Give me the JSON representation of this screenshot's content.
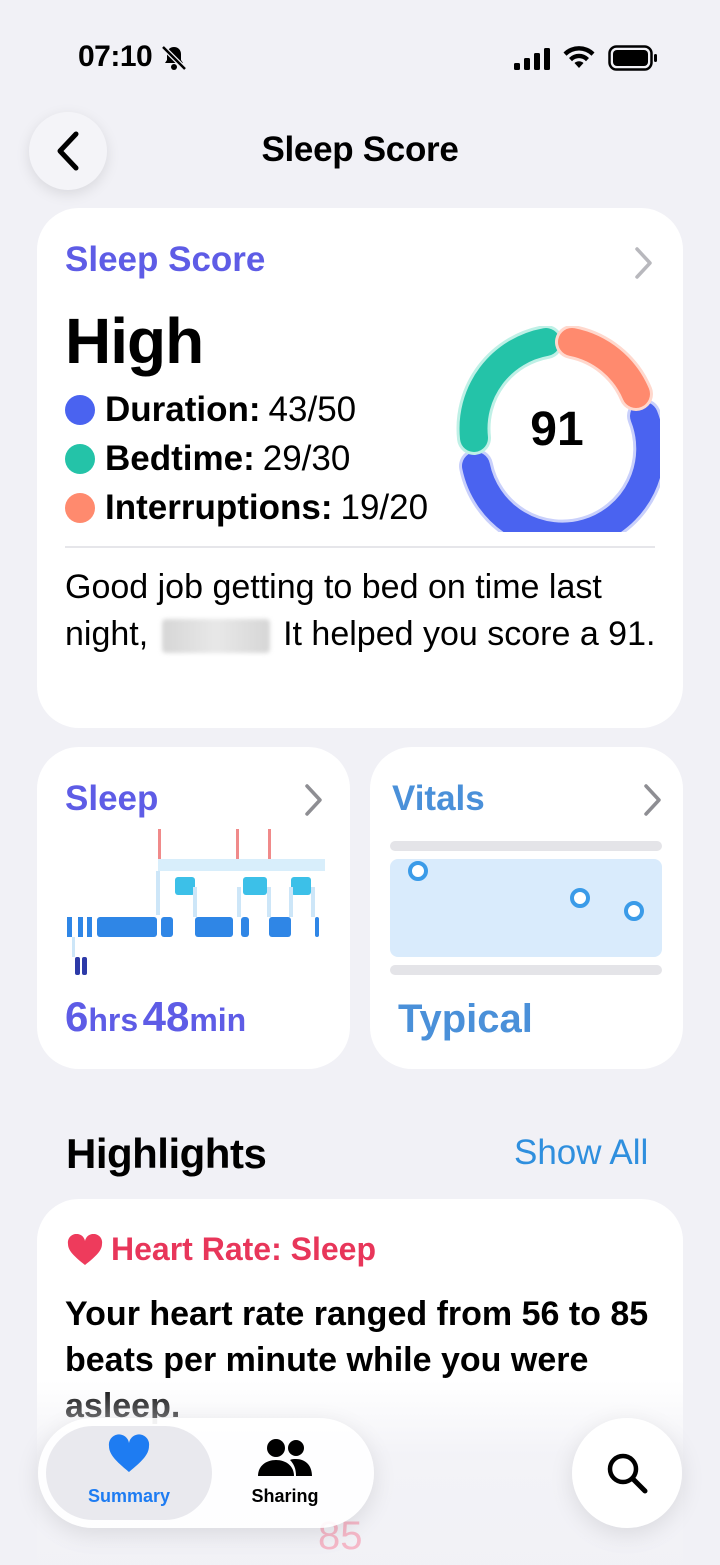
{
  "status_bar": {
    "time": "07:10"
  },
  "nav": {
    "title": "Sleep Score"
  },
  "score_card": {
    "title": "Sleep Score",
    "level": "High",
    "score": "91",
    "metrics": [
      {
        "label": "Duration:",
        "value": "43/50",
        "color": "#4a63f0"
      },
      {
        "label": "Bedtime:",
        "value": "29/30",
        "color": "#24c3a8"
      },
      {
        "label": "Interruptions:",
        "value": "19/20",
        "color": "#ff8a6e"
      }
    ],
    "message_part1": "Good job getting to bed on time last night,",
    "message_part2": "It helped you score a 91."
  },
  "sleep_card": {
    "title": "Sleep",
    "hours": "6",
    "hours_unit": "hrs",
    "minutes": "48",
    "minutes_unit": "min"
  },
  "vitals_card": {
    "title": "Vitals",
    "status": "Typical"
  },
  "highlights": {
    "title": "Highlights",
    "show_all": "Show All"
  },
  "heart_rate_card": {
    "title": "Heart Rate: Sleep",
    "text": "Your heart rate ranged from 56 to 85 beats per minute while you were asleep.",
    "ghost_value": "85"
  },
  "tab_bar": {
    "items": [
      {
        "label": "Summary",
        "active": true
      },
      {
        "label": "Sharing",
        "active": false
      }
    ]
  },
  "colors": {
    "accent_purple": "#5e5ce6",
    "link_blue": "#2f8fde",
    "heart_red": "#e8365a"
  }
}
